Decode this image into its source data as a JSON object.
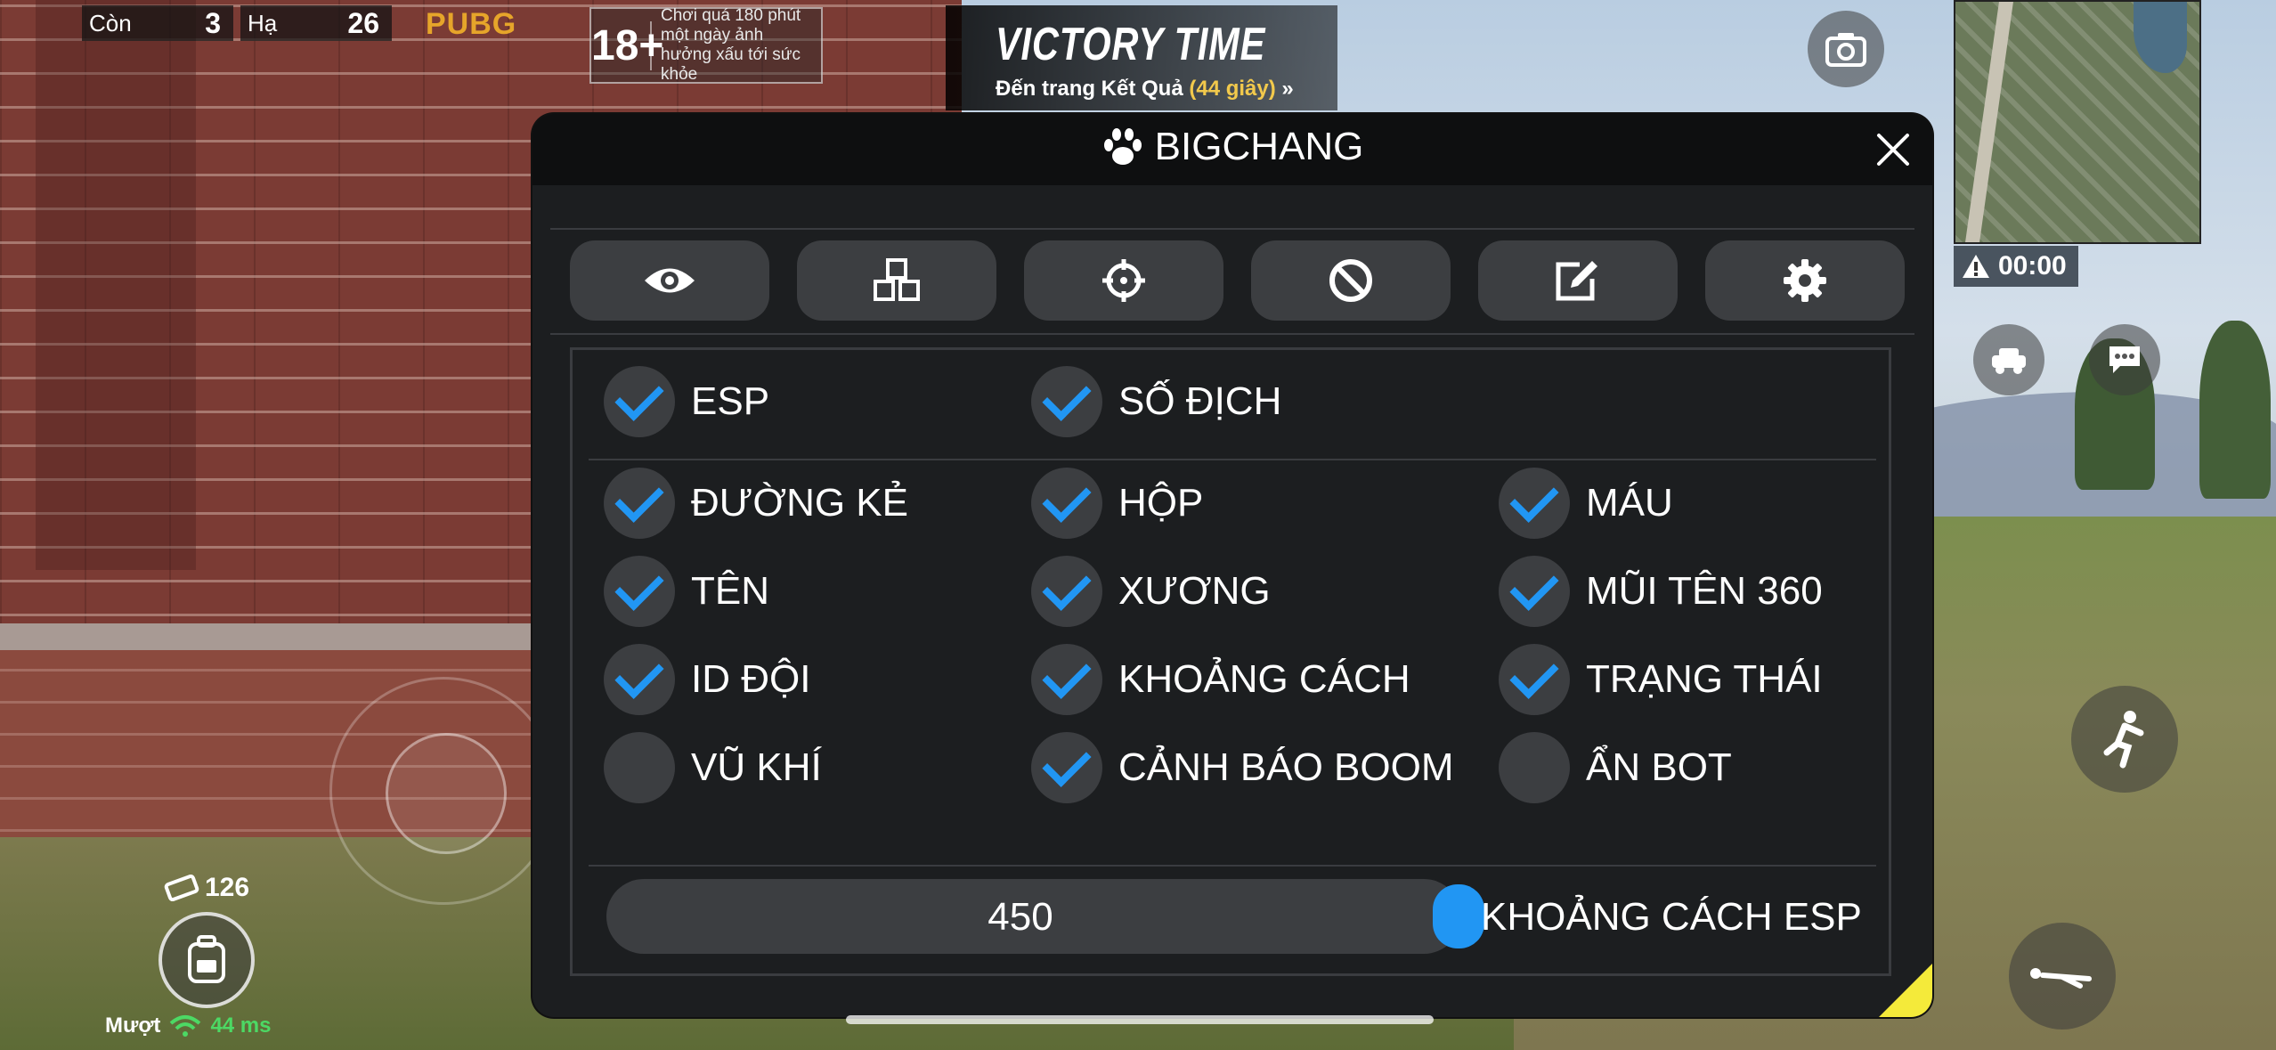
{
  "hud": {
    "alive_label": "Còn",
    "alive_count": "3",
    "kills_label": "Hạ",
    "kills_count": "26",
    "logo_text": "PUBG",
    "age_badge": "18+",
    "age_warning": "Chơi quá 180 phút một ngày ảnh hưởng xấu tới sức khỏe",
    "victory_title": "VICTORY TIME",
    "victory_sub": "Đến trang Kết Quả",
    "victory_seconds": "(44 giây)",
    "victory_arrow": "»",
    "timer": "00:00",
    "ammo": "126",
    "network_label": "Mượt",
    "ping": "44 ms"
  },
  "menu": {
    "title": "BIGCHANG",
    "tabs": [
      {
        "icon": "eye-icon"
      },
      {
        "icon": "cubes-icon"
      },
      {
        "icon": "crosshair-icon"
      },
      {
        "icon": "ban-icon"
      },
      {
        "icon": "edit-icon"
      },
      {
        "icon": "gear-icon"
      }
    ],
    "options": [
      {
        "label": "ESP",
        "checked": true
      },
      {
        "label": "SỐ ĐỊCH",
        "checked": true
      },
      {
        "label": "ĐƯỜNG KẺ",
        "checked": true
      },
      {
        "label": "HỘP",
        "checked": true
      },
      {
        "label": "MÁU",
        "checked": true
      },
      {
        "label": "TÊN",
        "checked": true
      },
      {
        "label": "XƯƠNG",
        "checked": true
      },
      {
        "label": "MŨI TÊN 360",
        "checked": true
      },
      {
        "label": "ID ĐỘI",
        "checked": true
      },
      {
        "label": "KHOẢNG CÁCH",
        "checked": true
      },
      {
        "label": "TRẠNG THÁI",
        "checked": true
      },
      {
        "label": "VŨ KHÍ",
        "checked": false
      },
      {
        "label": "CẢNH BÁO BOOM",
        "checked": true
      },
      {
        "label": "ẨN BOT",
        "checked": false
      }
    ],
    "slider": {
      "value": "450",
      "label": "KHOẢNG CÁCH ESP"
    }
  },
  "colors": {
    "accent": "#2196f3",
    "panel": "#1c1e20",
    "control": "#3c3e41",
    "corner": "#f4ea3a"
  }
}
